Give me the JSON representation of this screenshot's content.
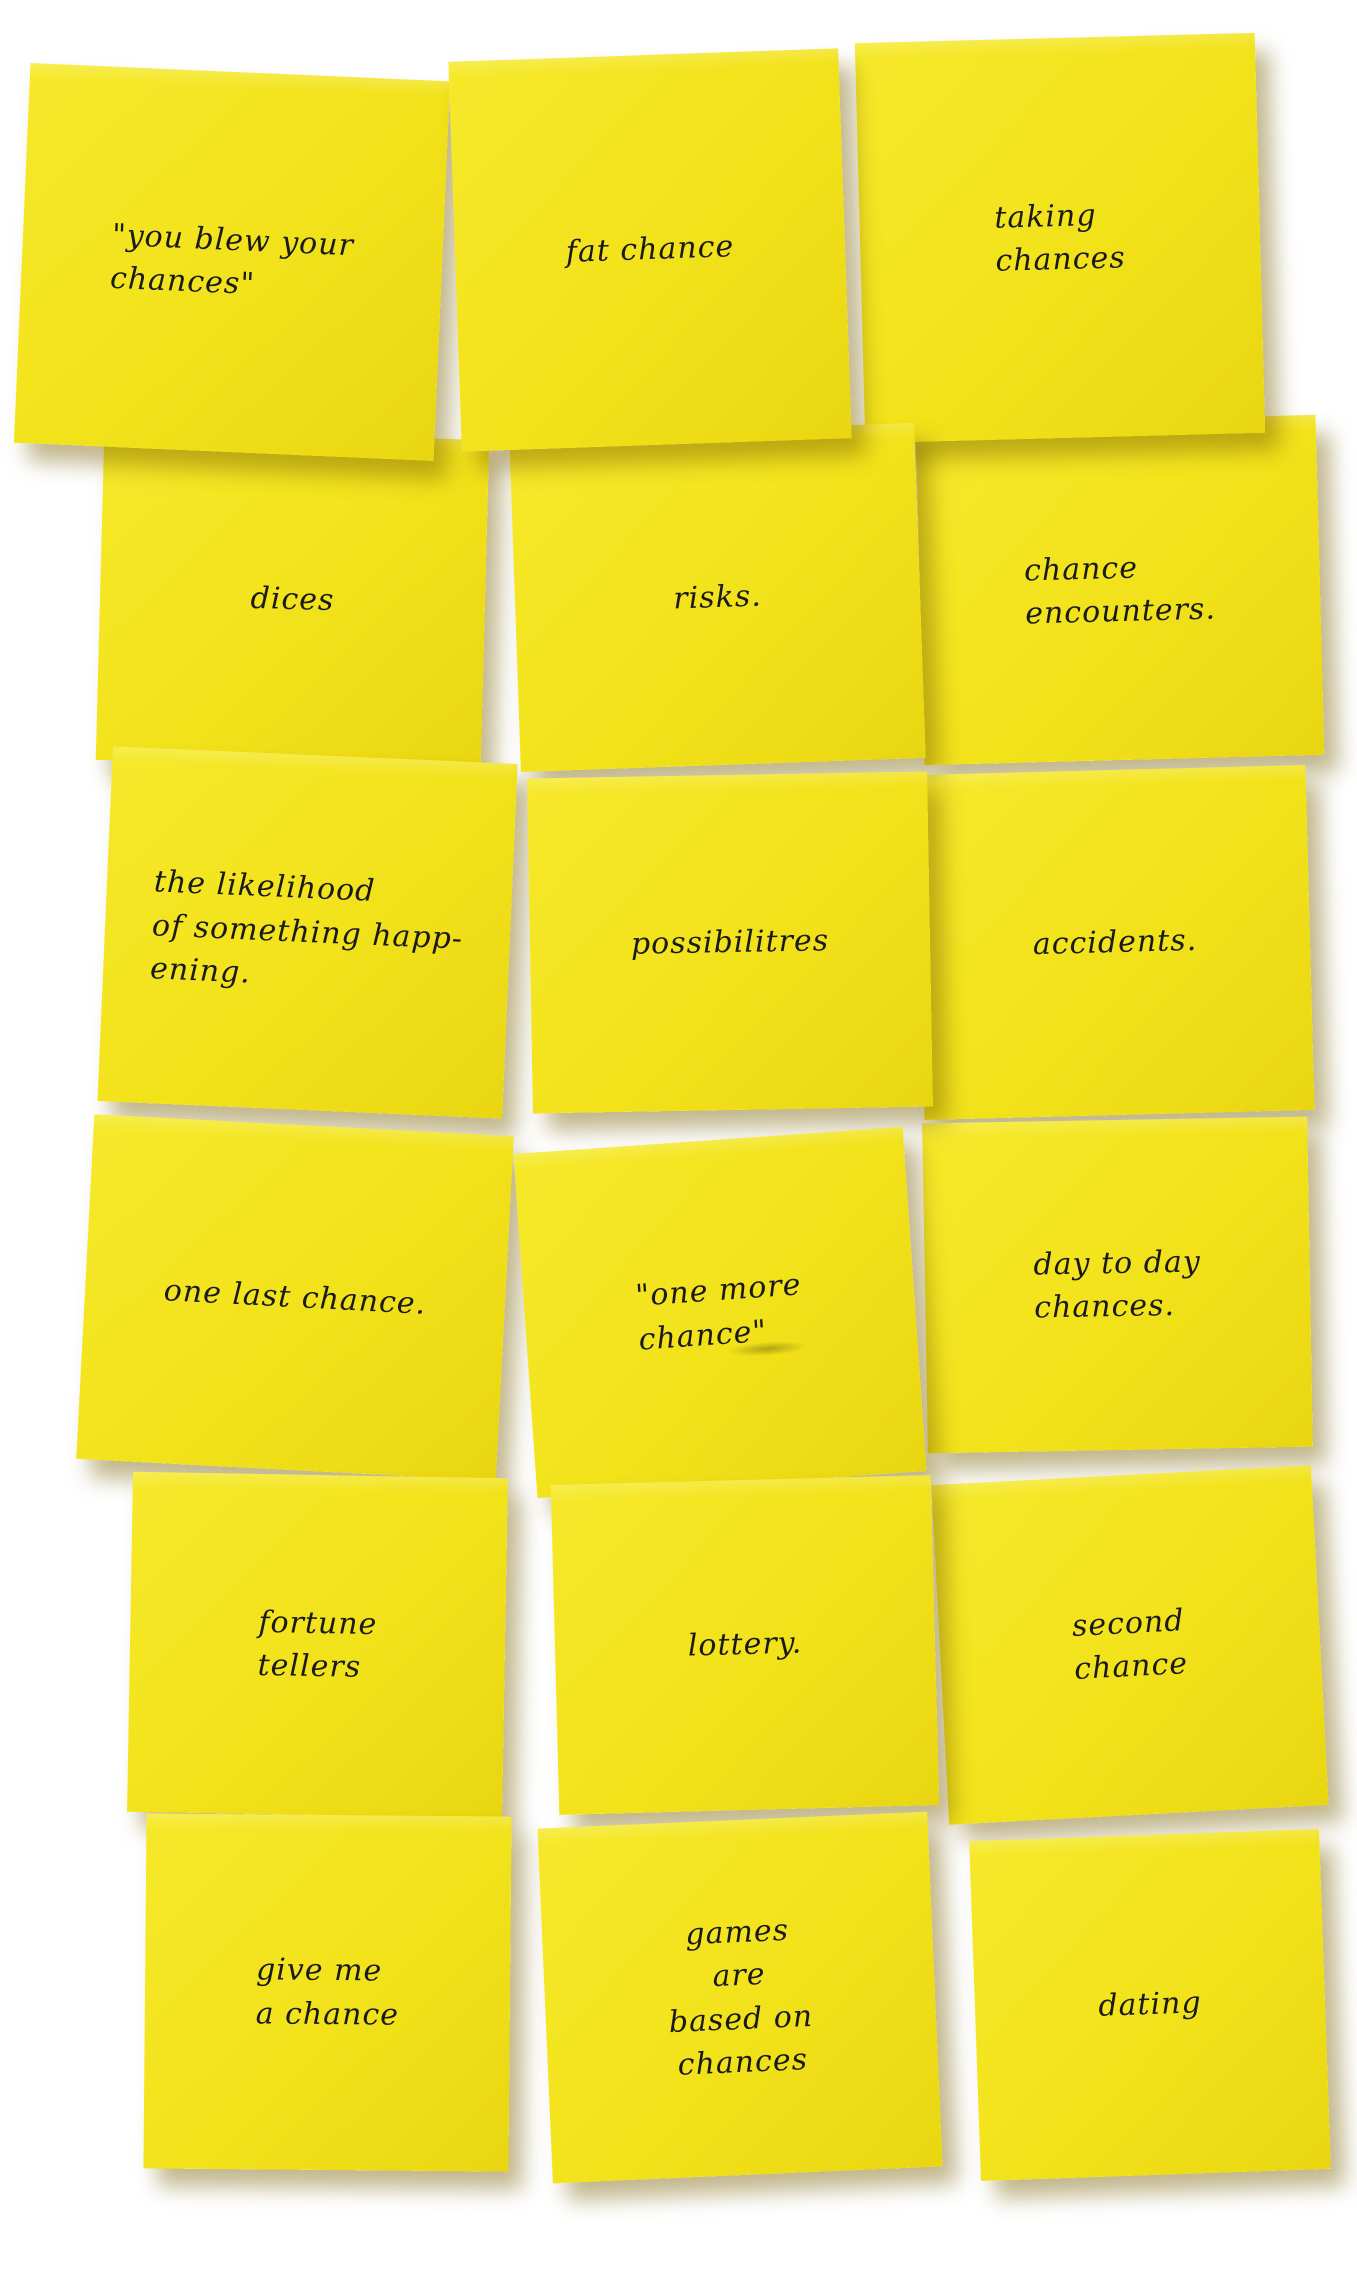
{
  "notes": [
    {
      "text": "\"you blew your\nchances\""
    },
    {
      "text": "fat chance"
    },
    {
      "text": "taking\nchances"
    },
    {
      "text": "dices"
    },
    {
      "text": "risks."
    },
    {
      "text": "chance\nencounters."
    },
    {
      "text": "the likelihood\nof something happ-\nening."
    },
    {
      "text": "possibilitres"
    },
    {
      "text": "accidents."
    },
    {
      "text": "one last chance."
    },
    {
      "text": "\"one more\nchance\""
    },
    {
      "text": "day to day\nchances."
    },
    {
      "text": "fortune\ntellers"
    },
    {
      "text": "lottery."
    },
    {
      "text": "second\nchance"
    },
    {
      "text": "give me\na chance"
    },
    {
      "text": "games\nare\nbased on\nchances"
    },
    {
      "text": "dating"
    }
  ],
  "colors": {
    "note": "#f2e21a",
    "ink": "#1a1a1a",
    "background": "#ffffff"
  }
}
